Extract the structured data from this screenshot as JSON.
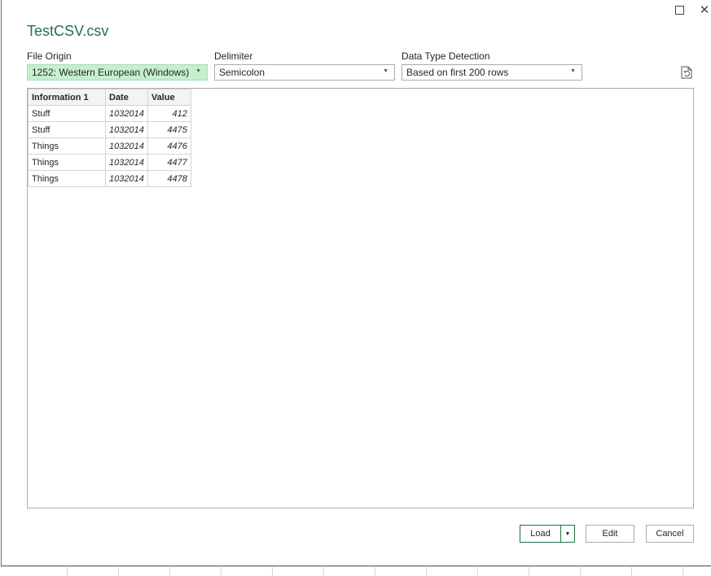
{
  "window": {
    "maximize_icon": "maximize-icon",
    "close_glyph": "✕"
  },
  "title": "TestCSV.csv",
  "file_origin": {
    "label": "File Origin",
    "value": "1252: Western European (Windows)"
  },
  "delimiter": {
    "label": "Delimiter",
    "value": "Semicolon"
  },
  "detection": {
    "label": "Data Type Detection",
    "value": "Based on first 200 rows"
  },
  "table": {
    "headers": [
      "Information 1",
      "Date",
      "Value"
    ],
    "rows": [
      [
        "Stuff",
        "1032014",
        "412"
      ],
      [
        "Stuff",
        "1032014",
        "4475"
      ],
      [
        "Things",
        "1032014",
        "4476"
      ],
      [
        "Things",
        "1032014",
        "4477"
      ],
      [
        "Things",
        "1032014",
        "4478"
      ]
    ]
  },
  "buttons": {
    "load": "Load",
    "edit": "Edit",
    "cancel": "Cancel"
  },
  "colors": {
    "accent": "#217346",
    "selected_bg": "#c6efce"
  }
}
